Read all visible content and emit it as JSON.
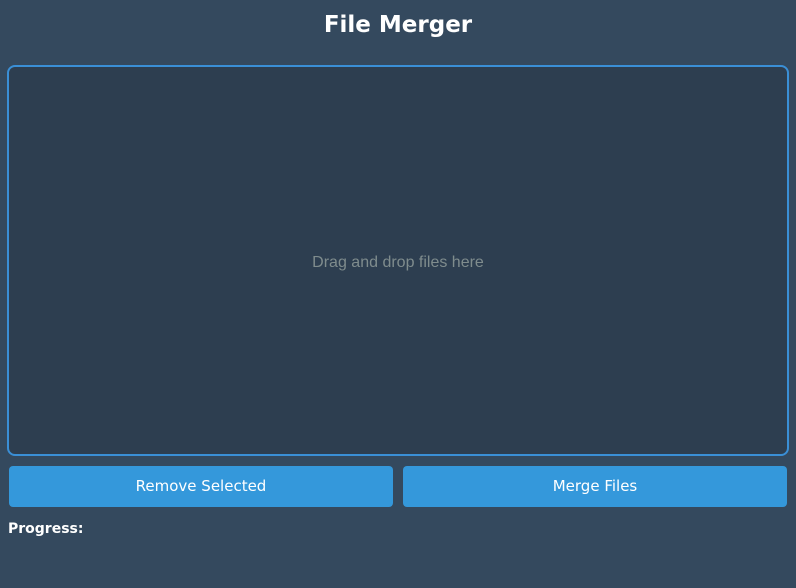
{
  "app": {
    "title": "File Merger"
  },
  "drop_zone": {
    "hint": "Drag and drop files here"
  },
  "actions": {
    "remove_label": "Remove Selected",
    "merge_label": "Merge Files"
  },
  "progress": {
    "label": "Progress:"
  },
  "colors": {
    "background": "#34495e",
    "drop_zone_bg": "#2d3e50",
    "drop_zone_border": "#3a8fd6",
    "button": "#3498db",
    "hint_text": "#7f8c8d"
  }
}
